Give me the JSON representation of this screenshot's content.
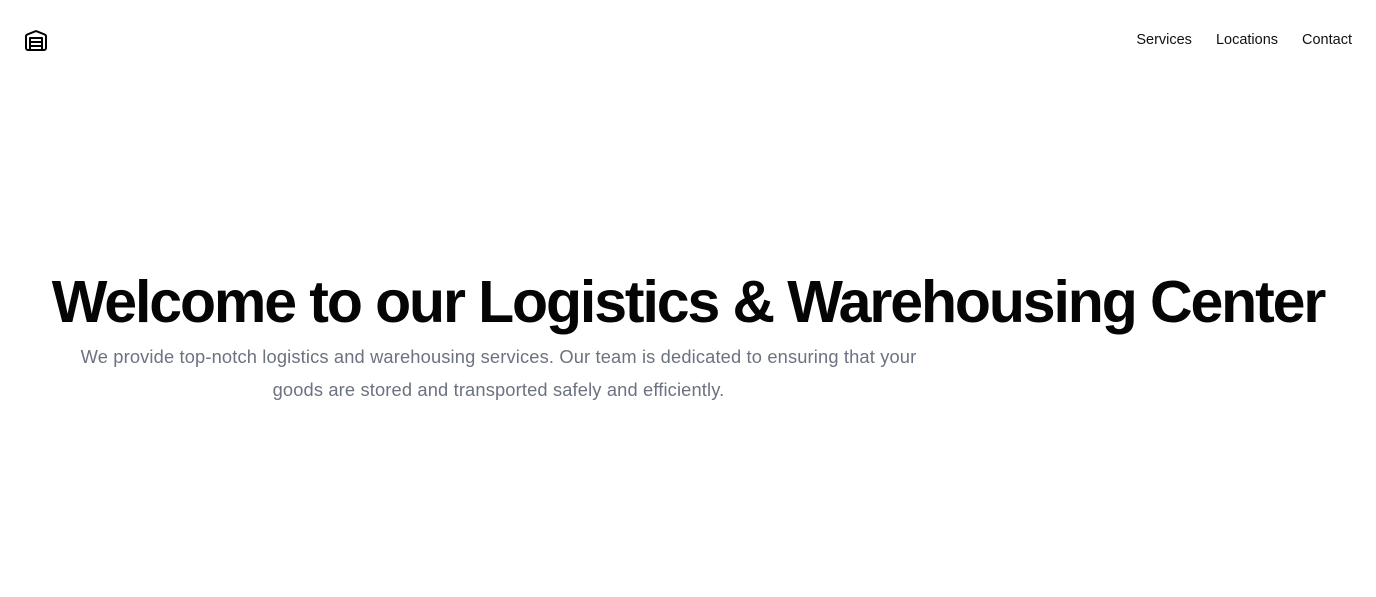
{
  "header": {
    "logo_icon": "warehouse-icon",
    "nav": {
      "services": "Services",
      "locations": "Locations",
      "contact": "Contact"
    }
  },
  "hero": {
    "title": "Welcome to our Logistics & Warehousing Center",
    "description": "We provide top-notch logistics and warehousing services. Our team is dedicated to ensuring that your goods are stored and transported safely and efficiently."
  },
  "colors": {
    "background": "#ffffff",
    "title": "#050505",
    "body_text": "#6b7280",
    "nav_text": "#111111"
  }
}
